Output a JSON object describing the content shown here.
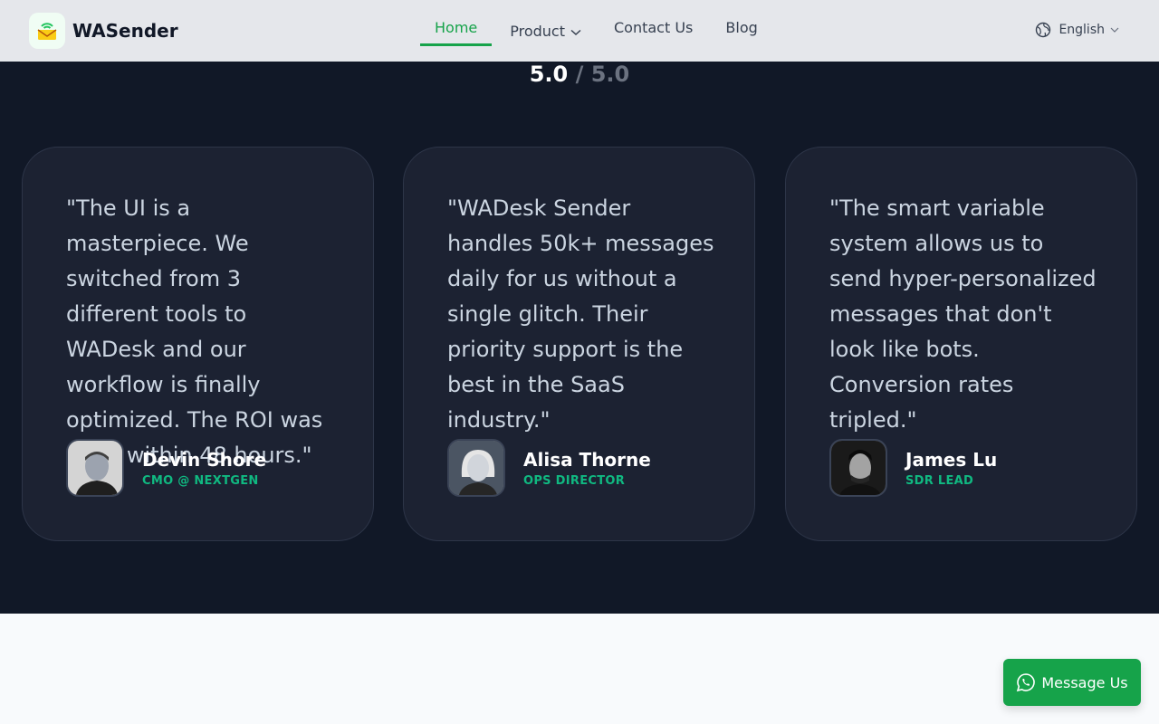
{
  "header": {
    "brand": "WASender",
    "nav": {
      "home": "Home",
      "product": "Product",
      "contact": "Contact Us",
      "blog": "Blog"
    },
    "language": "English"
  },
  "rating": {
    "score": "5.0",
    "max": "/ 5.0"
  },
  "testimonials": [
    {
      "quote": "\"The UI is a masterpiece. We switched from 3 different tools to WADesk and our workflow is finally optimized. The ROI was clear within 48 hours.\"",
      "name": "Devin Shore",
      "role": "CMO @ NEXTGEN"
    },
    {
      "quote": "\"WADesk Sender handles 50k+ messages daily for us without a single glitch. Their priority support is the best in the SaaS industry.\"",
      "name": "Alisa Thorne",
      "role": "OPS DIRECTOR"
    },
    {
      "quote": "\"The smart variable system allows us to send hyper-personalized messages that don't look like bots. Conversion rates tripled.\"",
      "name": "James Lu",
      "role": "SDR LEAD"
    }
  ],
  "message_button": "Message Us",
  "colors": {
    "accent": "#16a34a",
    "dark_bg": "#111827",
    "card_bg": "#1c2232",
    "role": "#10b981"
  }
}
